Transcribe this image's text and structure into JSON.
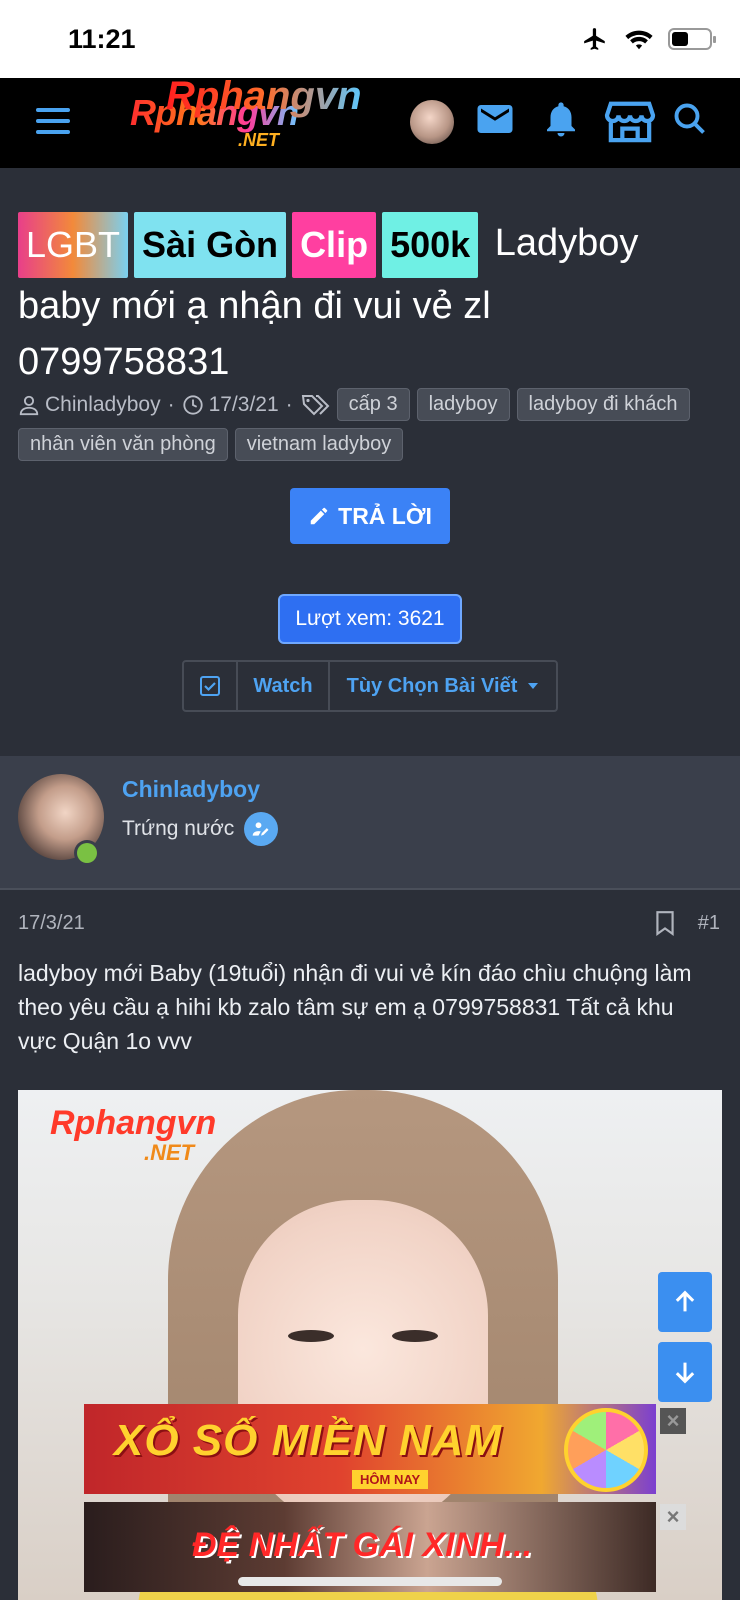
{
  "status_bar": {
    "time": "11:21"
  },
  "header": {
    "logo_text": "Rphangvn",
    "logo_suffix": ".NET",
    "icons": [
      "menu-icon",
      "avatar",
      "mail-icon",
      "bell-icon",
      "store-icon",
      "search-icon"
    ],
    "accent": "#4aa3f0"
  },
  "thread": {
    "prefixes": [
      {
        "label": "LGBT"
      },
      {
        "label": "Sài Gòn"
      },
      {
        "label": "Clip"
      },
      {
        "label": "500k"
      }
    ],
    "title": "Ladyboy baby mới ạ nhận đi vui vẻ zl 0799758831",
    "author": "Chinladyboy",
    "date": "17/3/21",
    "tags": [
      "cấp 3",
      "ladyboy",
      "ladyboy đi khách",
      "nhân viên văn phòng",
      "vietnam ladyboy"
    ],
    "reply_label": "TRẢ LỜI",
    "views_label": "Lượt xem: 3621",
    "watch_label": "Watch",
    "options_label": "Tùy Chọn Bài Viết"
  },
  "user": {
    "name": "Chinladyboy",
    "rank": "Trứng nước"
  },
  "post": {
    "date": "17/3/21",
    "number": "#1",
    "body": "ladyboy mới Baby (19tuổi) nhận đi vui vẻ kín đáo chìu chuộng làm theo yêu cầu ạ hihi kb zalo tâm sự em ạ 0799758831 Tất cả khu vực Quận 1o vvv",
    "image_watermark": "Rphangvn",
    "image_watermark_suffix": ".NET"
  },
  "ads": [
    {
      "text": "XỔ SỐ MIỀN NAM",
      "subtext": "HÔM NAY"
    },
    {
      "text": "ĐỆ NHẤT GÁI XINH..."
    }
  ],
  "colors": {
    "background": "#2b2f38",
    "primary_button": "#3b82f6",
    "link": "#4ea3f2",
    "online": "#7ac143"
  }
}
